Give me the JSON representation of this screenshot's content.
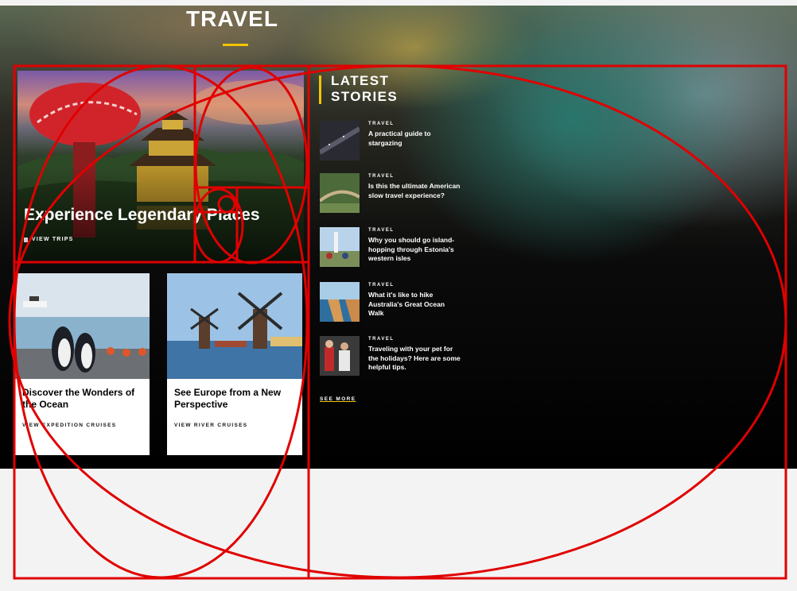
{
  "page": {
    "section_title": "TRAVEL"
  },
  "feature": {
    "title": "Experience Legendary Places",
    "link_label": "VIEW TRIPS"
  },
  "cards": [
    {
      "title": "Discover the Wonders of the Ocean",
      "link_label": "VIEW EXPEDITION CRUISES"
    },
    {
      "title": "See Europe from a New Perspective",
      "link_label": "VIEW RIVER CRUISES"
    }
  ],
  "latest": {
    "heading": "LATEST STORIES",
    "see_more_label": "SEE MORE",
    "stories": [
      {
        "category": "TRAVEL",
        "title": "A practical guide to stargazing"
      },
      {
        "category": "TRAVEL",
        "title": "Is this the ultimate American slow travel experience?"
      },
      {
        "category": "TRAVEL",
        "title": "Why you should go island-hopping through Estonia's western isles"
      },
      {
        "category": "TRAVEL",
        "title": "What it's like to hike Australia's Great Ocean Walk"
      },
      {
        "category": "TRAVEL",
        "title": "Traveling with your pet for the holidays? Here are some helpful tips."
      }
    ]
  },
  "colors": {
    "accent": "#f2c500",
    "overlay_red": "#e00000",
    "page_bg": "#f3f3f3"
  },
  "icons": {
    "feature_link": "play-square-icon"
  }
}
